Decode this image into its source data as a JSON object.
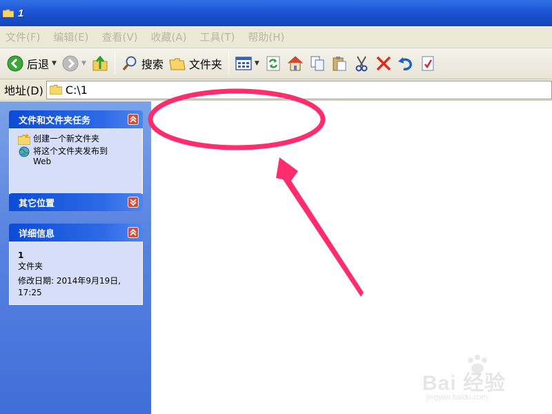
{
  "window": {
    "title": "1"
  },
  "menu": [
    "文件(F)",
    "编辑(E)",
    "查看(V)",
    "收藏(A)",
    "工具(T)",
    "帮助(H)"
  ],
  "toolbar": {
    "back_label": "后退",
    "search_label": "搜索",
    "folders_label": "文件夹"
  },
  "address": {
    "label": "地址(D)",
    "path": "C:\\1"
  },
  "tasks_panel": {
    "title": "文件和文件夹任务",
    "items": [
      {
        "label": "创建一个新文件夹",
        "icon": "new-folder-icon"
      },
      {
        "label": "将这个文件夹发布到",
        "label2": "Web",
        "icon": "publish-web-icon"
      }
    ]
  },
  "other_places": {
    "title": "其它位置"
  },
  "details": {
    "title": "详细信息",
    "name": "1",
    "type": "文件夹",
    "modified": "修改日期: 2014年9月19日,",
    "modified2": "17:25"
  },
  "watermark": {
    "brand": "Bai 经验",
    "url": "jingyan.baidu.com"
  },
  "colors": {
    "titlebar": "#1d55d6",
    "annotation": "#ff2d6e",
    "panel": "#5a85e0"
  }
}
